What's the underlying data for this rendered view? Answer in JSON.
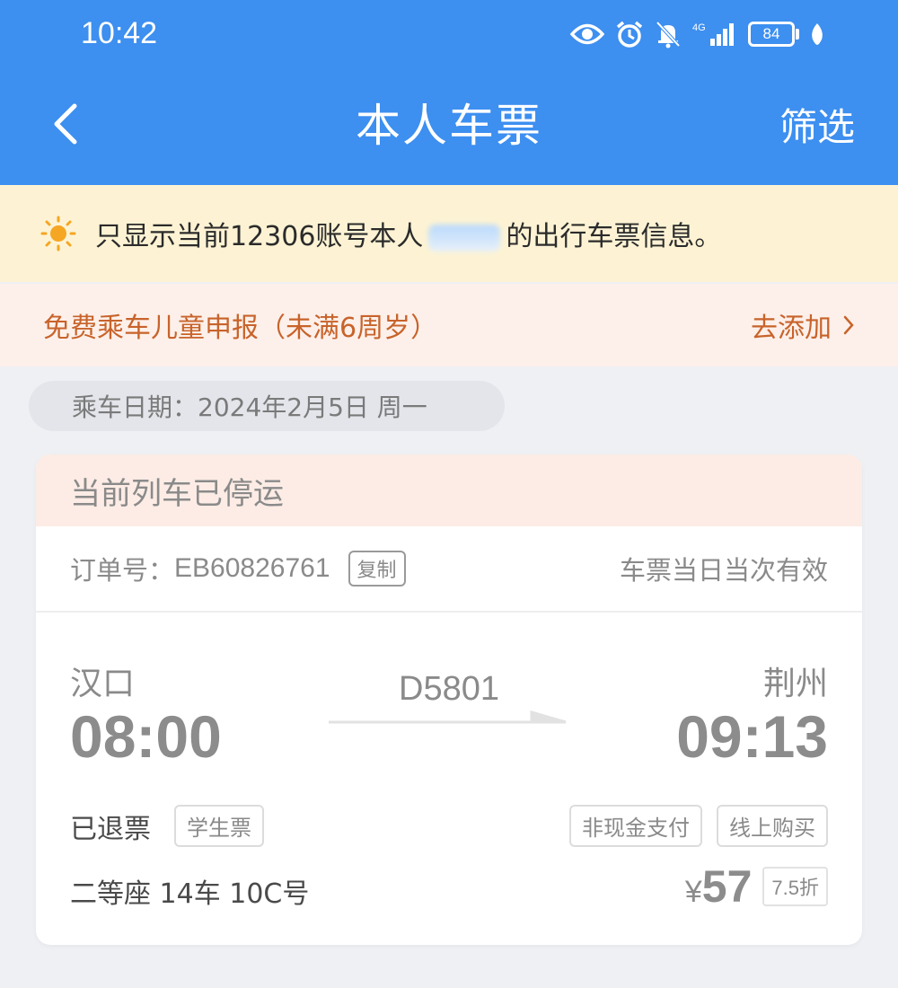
{
  "status_bar": {
    "time": "10:42",
    "battery": "84",
    "network": "4G",
    "icons": [
      "eye-icon",
      "alarm-icon",
      "bell-off-icon",
      "signal-icon",
      "battery-icon",
      "leaf-icon"
    ]
  },
  "nav": {
    "title": "本人车票",
    "filter_label": "筛选",
    "back_icon": "chevron-left-icon"
  },
  "notice": {
    "text_before": "只显示当前12306账号本人",
    "text_after": "的出行车票信息。",
    "icon": "sun-icon"
  },
  "child_banner": {
    "text": "免费乘车儿童申报（未满6周岁）",
    "link_label": "去添加"
  },
  "date": {
    "label": "乘车日期：2024年2月5日 周一"
  },
  "ticket": {
    "status": "当前列车已停运",
    "order_label": "订单号：",
    "order_no": "EB60826761",
    "copy_label": "复制",
    "validity": "车票当日当次有效",
    "from_station": "汉口",
    "to_station": "荆州",
    "depart_time": "08:00",
    "arrive_time": "09:13",
    "train_no": "D5801",
    "refund_status": "已退票",
    "ticket_type": "学生票",
    "payment_tag": "非现金支付",
    "channel_tag": "线上购买",
    "seat_info": "二等座 14车 10C号",
    "currency": "¥",
    "price": "57",
    "discount": "7.5折"
  },
  "colors": {
    "header_bg": "#3d8ff0",
    "notice_bg": "#fdf3d4",
    "child_banner_bg": "#fdf0ea",
    "accent_orange": "#c8632b",
    "sun": "#f5a623"
  }
}
